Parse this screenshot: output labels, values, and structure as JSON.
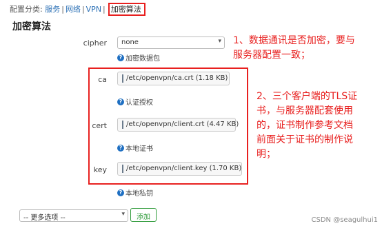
{
  "breadcrumb": {
    "prefix": "配置分类:",
    "items": [
      "服务",
      "网络",
      "VPN",
      "加密算法"
    ]
  },
  "section_title": "加密算法",
  "cipher": {
    "label": "cipher",
    "value": "none",
    "help": "加密数据包"
  },
  "ca": {
    "label": "ca",
    "file": "/etc/openvpn/ca.crt (1.18 KB)",
    "help": "认证授权"
  },
  "cert": {
    "label": "cert",
    "file": "/etc/openvpn/client.crt (4.47 KB)",
    "help": "本地证书"
  },
  "key": {
    "label": "key",
    "file": "/etc/openvpn/client.key (1.70 KB)",
    "help": "本地私钥"
  },
  "annotations": {
    "note1_line1": "1、数据通讯是否加密，要与",
    "note1_line2": "服务器配置一致；",
    "note2_line1": "2、三个客户端的TLS证",
    "note2_line2": "书，与服务器配套使用",
    "note2_line3": "的，证书制作参考文档",
    "note2_line4": "前面关于证书的制作说",
    "note2_line5": "明；"
  },
  "more_options": {
    "value": "-- 更多选项 --",
    "add_label": "添加"
  },
  "watermark": "CSDN @seagulhui1",
  "colors": {
    "link": "#2a6fb5",
    "annotation_red": "#e8201f",
    "help_icon": "#1e6fc2",
    "add_green": "#2f9b3a"
  },
  "icons": [
    "help-circle-icon",
    "file-icon",
    "chevron-down-icon"
  ]
}
